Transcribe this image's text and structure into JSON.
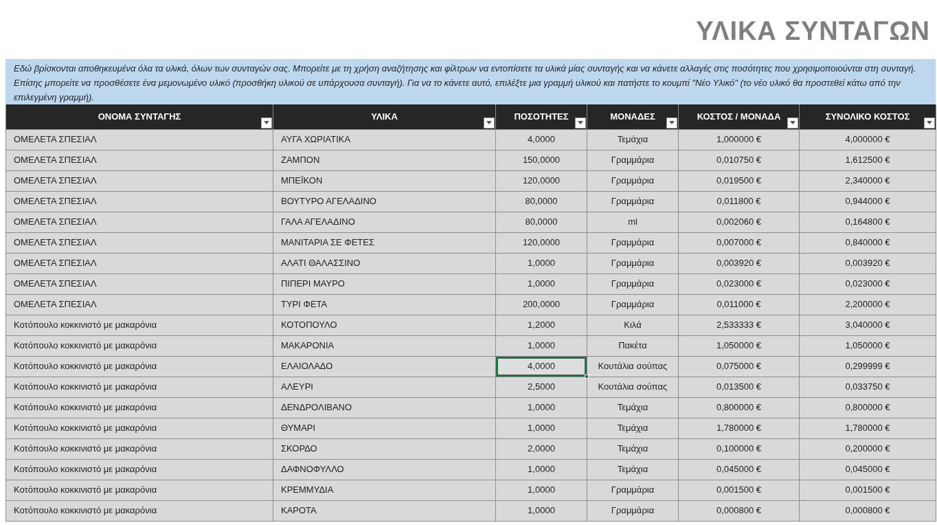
{
  "title": "ΥΛΙΚΑ ΣΥΝΤΑΓΩΝ",
  "info": "Εδώ βρίσκονται αποθηκευμένα όλα τα υλικά, όλων των συνταγών σας. Μπορείτε με τη χρήση αναζήτησης και φίλτρων να εντοπίσετε τα υλικά μίας συνταγής και να κάνετε αλλαγές στις ποσότητες που χρησιμοποιούνται στη συνταγή. Επίσης μπορείτε να προσθέσετε ένα μεμονωμένο υλικό (προσθήκη υλικού σε υπάρχουσα συνταγή). Για να το κάνετε αυτό, επιλέξτε μια  γραμμή υλικού και πατήστε το κουμπί \"Νέο Υλικό\" (το νέο υλικό θα προστεθεί κάτω από την επιλεγμένη γραμμή).",
  "table": {
    "columns": [
      "ΟΝΟΜΑ ΣΥΝΤΑΓΗΣ",
      "ΥΛΙΚΑ",
      "ΠΟΣΟΤΗΤΕΣ",
      "ΜΟΝΑΔΕΣ",
      "ΚΟΣΤΟΣ / ΜΟΝΑΔΑ",
      "ΣΥΝΟΛΙΚΟ ΚΟΣΤΟΣ"
    ],
    "rows": [
      {
        "cells": [
          {
            "text": "ΟΜΕΛΕΤΑ ΣΠΕΣΙΑΛ",
            "selected": false
          },
          {
            "text": "ΑΥΓΑ ΧΩΡΙΑΤΙΚΑ",
            "selected": false
          },
          {
            "text": "4,0000",
            "selected": false
          },
          {
            "text": "Τεμάχια",
            "selected": false
          },
          {
            "text": "1,000000 €",
            "selected": false
          },
          {
            "text": "4,000000 €",
            "selected": false
          }
        ]
      },
      {
        "cells": [
          {
            "text": "ΟΜΕΛΕΤΑ ΣΠΕΣΙΑΛ",
            "selected": false
          },
          {
            "text": "ΖΑΜΠΟΝ",
            "selected": false
          },
          {
            "text": "150,0000",
            "selected": false
          },
          {
            "text": "Γραμμάρια",
            "selected": false
          },
          {
            "text": "0,010750 €",
            "selected": false
          },
          {
            "text": "1,612500 €",
            "selected": false
          }
        ]
      },
      {
        "cells": [
          {
            "text": "ΟΜΕΛΕΤΑ ΣΠΕΣΙΑΛ",
            "selected": false
          },
          {
            "text": "ΜΠΕΪΚΟΝ",
            "selected": false
          },
          {
            "text": "120,0000",
            "selected": false
          },
          {
            "text": "Γραμμάρια",
            "selected": false
          },
          {
            "text": "0,019500 €",
            "selected": false
          },
          {
            "text": "2,340000 €",
            "selected": false
          }
        ]
      },
      {
        "cells": [
          {
            "text": "ΟΜΕΛΕΤΑ ΣΠΕΣΙΑΛ",
            "selected": false
          },
          {
            "text": "ΒΟΥΤΥΡΟ ΑΓΕΛΑΔΙΝΟ",
            "selected": false
          },
          {
            "text": "80,0000",
            "selected": false
          },
          {
            "text": "Γραμμάρια",
            "selected": false
          },
          {
            "text": "0,011800 €",
            "selected": false
          },
          {
            "text": "0,944000 €",
            "selected": false
          }
        ]
      },
      {
        "cells": [
          {
            "text": "ΟΜΕΛΕΤΑ ΣΠΕΣΙΑΛ",
            "selected": false
          },
          {
            "text": "ΓΑΛΑ ΑΓΕΛΑΔΙΝΟ",
            "selected": false
          },
          {
            "text": "80,0000",
            "selected": false
          },
          {
            "text": "ml",
            "selected": false
          },
          {
            "text": "0,002060 €",
            "selected": false
          },
          {
            "text": "0,164800 €",
            "selected": false
          }
        ]
      },
      {
        "cells": [
          {
            "text": "ΟΜΕΛΕΤΑ ΣΠΕΣΙΑΛ",
            "selected": false
          },
          {
            "text": "ΜΑΝΙΤΑΡΙΑ ΣΕ ΦΕΤΕΣ",
            "selected": false
          },
          {
            "text": "120,0000",
            "selected": false
          },
          {
            "text": "Γραμμάρια",
            "selected": false
          },
          {
            "text": "0,007000 €",
            "selected": false
          },
          {
            "text": "0,840000 €",
            "selected": false
          }
        ]
      },
      {
        "cells": [
          {
            "text": "ΟΜΕΛΕΤΑ ΣΠΕΣΙΑΛ",
            "selected": false
          },
          {
            "text": "ΑΛΑΤΙ ΘΑΛΑΣΣΙΝΟ",
            "selected": false
          },
          {
            "text": "1,0000",
            "selected": false
          },
          {
            "text": "Γραμμάρια",
            "selected": false
          },
          {
            "text": "0,003920 €",
            "selected": false
          },
          {
            "text": "0,003920 €",
            "selected": false
          }
        ]
      },
      {
        "cells": [
          {
            "text": "ΟΜΕΛΕΤΑ ΣΠΕΣΙΑΛ",
            "selected": false
          },
          {
            "text": "ΠΙΠΕΡΙ ΜΑΥΡΟ",
            "selected": false
          },
          {
            "text": "1,0000",
            "selected": false
          },
          {
            "text": "Γραμμάρια",
            "selected": false
          },
          {
            "text": "0,023000 €",
            "selected": false
          },
          {
            "text": "0,023000 €",
            "selected": false
          }
        ]
      },
      {
        "cells": [
          {
            "text": "ΟΜΕΛΕΤΑ ΣΠΕΣΙΑΛ",
            "selected": false
          },
          {
            "text": "ΤΥΡΙ ΦΕΤΑ",
            "selected": false
          },
          {
            "text": "200,0000",
            "selected": false
          },
          {
            "text": "Γραμμάρια",
            "selected": false
          },
          {
            "text": "0,011000 €",
            "selected": false
          },
          {
            "text": "2,200000 €",
            "selected": false
          }
        ]
      },
      {
        "cells": [
          {
            "text": "Κοτόπουλο κοκκινιστό με μακαρόνια",
            "selected": false
          },
          {
            "text": "ΚΟΤΟΠΟΥΛΟ",
            "selected": false
          },
          {
            "text": "1,2000",
            "selected": false
          },
          {
            "text": "Κιλά",
            "selected": false
          },
          {
            "text": "2,533333 €",
            "selected": false
          },
          {
            "text": "3,040000 €",
            "selected": false
          }
        ]
      },
      {
        "cells": [
          {
            "text": "Κοτόπουλο κοκκινιστό με μακαρόνια",
            "selected": false
          },
          {
            "text": "ΜΑΚΑΡΟΝΙΑ",
            "selected": false
          },
          {
            "text": "1,0000",
            "selected": false
          },
          {
            "text": "Πακέτα",
            "selected": false
          },
          {
            "text": "1,050000 €",
            "selected": false
          },
          {
            "text": "1,050000 €",
            "selected": false
          }
        ]
      },
      {
        "cells": [
          {
            "text": "Κοτόπουλο κοκκινιστό με μακαρόνια",
            "selected": false
          },
          {
            "text": "ΕΛΑΙΟΛΑΔΟ",
            "selected": false
          },
          {
            "text": "4,0000",
            "selected": true
          },
          {
            "text": "Κουτάλια σούπας",
            "selected": false
          },
          {
            "text": "0,075000 €",
            "selected": false
          },
          {
            "text": "0,299999 €",
            "selected": false
          }
        ]
      },
      {
        "cells": [
          {
            "text": "Κοτόπουλο κοκκινιστό με μακαρόνια",
            "selected": false
          },
          {
            "text": "ΑΛΕΥΡΙ",
            "selected": false
          },
          {
            "text": "2,5000",
            "selected": false
          },
          {
            "text": "Κουτάλια σούπας",
            "selected": false
          },
          {
            "text": "0,013500 €",
            "selected": false
          },
          {
            "text": "0,033750 €",
            "selected": false
          }
        ]
      },
      {
        "cells": [
          {
            "text": "Κοτόπουλο κοκκινιστό με μακαρόνια",
            "selected": false
          },
          {
            "text": "ΔΕΝΔΡΟΛΙΒΑΝΟ",
            "selected": false
          },
          {
            "text": "1,0000",
            "selected": false
          },
          {
            "text": "Τεμάχια",
            "selected": false
          },
          {
            "text": "0,800000 €",
            "selected": false
          },
          {
            "text": "0,800000 €",
            "selected": false
          }
        ]
      },
      {
        "cells": [
          {
            "text": "Κοτόπουλο κοκκινιστό με μακαρόνια",
            "selected": false
          },
          {
            "text": "ΘΥΜΑΡΙ",
            "selected": false
          },
          {
            "text": "1,0000",
            "selected": false
          },
          {
            "text": "Τεμάχια",
            "selected": false
          },
          {
            "text": "1,780000 €",
            "selected": false
          },
          {
            "text": "1,780000 €",
            "selected": false
          }
        ]
      },
      {
        "cells": [
          {
            "text": "Κοτόπουλο κοκκινιστό με μακαρόνια",
            "selected": false
          },
          {
            "text": "ΣΚΟΡΔΟ",
            "selected": false
          },
          {
            "text": "2,0000",
            "selected": false
          },
          {
            "text": "Τεμάχια",
            "selected": false
          },
          {
            "text": "0,100000 €",
            "selected": false
          },
          {
            "text": "0,200000 €",
            "selected": false
          }
        ]
      },
      {
        "cells": [
          {
            "text": "Κοτόπουλο κοκκινιστό με μακαρόνια",
            "selected": false
          },
          {
            "text": "ΔΑΦΝΟΦΥΛΛΟ",
            "selected": false
          },
          {
            "text": "1,0000",
            "selected": false
          },
          {
            "text": "Τεμάχια",
            "selected": false
          },
          {
            "text": "0,045000 €",
            "selected": false
          },
          {
            "text": "0,045000 €",
            "selected": false
          }
        ]
      },
      {
        "cells": [
          {
            "text": "Κοτόπουλο κοκκινιστό με μακαρόνια",
            "selected": false
          },
          {
            "text": "ΚΡΕΜΜΥΔΙΑ",
            "selected": false
          },
          {
            "text": "1,0000",
            "selected": false
          },
          {
            "text": "Γραμμάρια",
            "selected": false
          },
          {
            "text": "0,001500 €",
            "selected": false
          },
          {
            "text": "0,001500 €",
            "selected": false
          }
        ]
      },
      {
        "cells": [
          {
            "text": "Κοτόπουλο κοκκινιστό με μακαρόνια",
            "selected": false
          },
          {
            "text": "ΚΑΡΟΤΑ",
            "selected": false
          },
          {
            "text": "1,0000",
            "selected": false
          },
          {
            "text": "Γραμμάρια",
            "selected": false
          },
          {
            "text": "0,000800 €",
            "selected": false
          },
          {
            "text": "0,000800 €",
            "selected": false
          }
        ]
      }
    ]
  }
}
